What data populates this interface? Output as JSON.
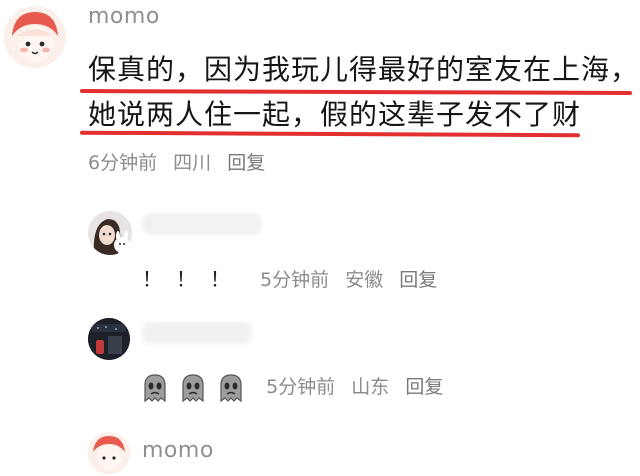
{
  "comments": [
    {
      "username": "momo",
      "lines": [
        "保真的，因为我玩儿得最好的室友在上海，",
        "她说两人住一起，假的这辈子发不了财"
      ],
      "time": "6分钟前",
      "location": "四川",
      "reply": "回复"
    },
    {
      "content": "！！！",
      "time": "5分钟前",
      "location": "安徽",
      "reply": "回复"
    },
    {
      "emoji": [
        "ghost-emoji",
        "ghost-emoji",
        "ghost-emoji"
      ],
      "time": "5分钟前",
      "location": "山东",
      "reply": "回复"
    },
    {
      "username": "momo"
    }
  ],
  "colors": {
    "underline": "#e1302f",
    "meta_text": "#8c8c8c",
    "username_text": "#8f8f8f"
  }
}
